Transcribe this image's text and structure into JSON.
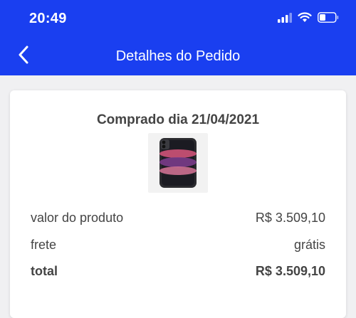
{
  "status_bar": {
    "time": "20:49",
    "icons": [
      "signal-icon",
      "wifi-icon",
      "battery-icon"
    ]
  },
  "nav": {
    "back_icon": "chevron-left-icon",
    "title": "Detalhes do Pedido"
  },
  "order": {
    "purchase_date_label": "Comprado dia 21/04/2021",
    "rows": [
      {
        "label": "valor do produto",
        "value": "R$ 3.509,10"
      },
      {
        "label": "frete",
        "value": "grátis"
      },
      {
        "label": "total",
        "value": "R$ 3.509,10"
      }
    ]
  },
  "colors": {
    "header_bg": "#1a3ff0",
    "text": "#444444",
    "page_bg": "#f0f0f2"
  }
}
